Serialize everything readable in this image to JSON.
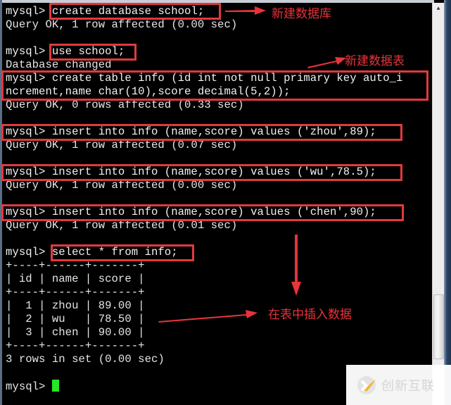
{
  "terminal": {
    "prompt": "mysql> ",
    "lines": [
      {
        "type": "cmd",
        "text": "mysql> create database school;"
      },
      {
        "type": "out",
        "text": "Query OK, 1 row affected (0.00 sec)"
      },
      {
        "type": "blank",
        "text": ""
      },
      {
        "type": "cmd",
        "text": "mysql> use school;"
      },
      {
        "type": "out",
        "text": "Database changed"
      },
      {
        "type": "cmd",
        "text": "mysql> create table info (id int not null primary key auto_i"
      },
      {
        "type": "cmd",
        "text": "ncrement,name char(10),score decimal(5,2));"
      },
      {
        "type": "out",
        "text": "Query OK, 0 rows affected (0.33 sec)"
      },
      {
        "type": "blank",
        "text": ""
      },
      {
        "type": "cmd",
        "text": "mysql> insert into info (name,score) values ('zhou',89);"
      },
      {
        "type": "out",
        "text": "Query OK, 1 row affected (0.07 sec)"
      },
      {
        "type": "blank",
        "text": ""
      },
      {
        "type": "cmd",
        "text": "mysql> insert into info (name,score) values ('wu',78.5);"
      },
      {
        "type": "out",
        "text": "Query OK, 1 row affected (0.00 sec)"
      },
      {
        "type": "blank",
        "text": ""
      },
      {
        "type": "cmd",
        "text": "mysql> insert into info (name,score) values ('chen',90);"
      },
      {
        "type": "out",
        "text": "Query OK, 1 row affected (0.01 sec)"
      },
      {
        "type": "blank",
        "text": ""
      },
      {
        "type": "cmd",
        "text": "mysql> select * from info;"
      },
      {
        "type": "out",
        "text": "+----+------+-------+"
      },
      {
        "type": "out",
        "text": "| id | name | score |"
      },
      {
        "type": "out",
        "text": "+----+------+-------+"
      },
      {
        "type": "out",
        "text": "|  1 | zhou | 89.00 |"
      },
      {
        "type": "out",
        "text": "|  2 | wu   | 78.50 |"
      },
      {
        "type": "out",
        "text": "|  3 | chen | 90.00 |"
      },
      {
        "type": "out",
        "text": "+----+------+-------+"
      },
      {
        "type": "out",
        "text": "3 rows in set (0.00 sec)"
      },
      {
        "type": "blank",
        "text": ""
      },
      {
        "type": "prompt",
        "text": "mysql> "
      }
    ],
    "result_table": {
      "columns": [
        "id",
        "name",
        "score"
      ],
      "rows": [
        [
          "1",
          "zhou",
          "89.00"
        ],
        [
          "2",
          "wu",
          "78.50"
        ],
        [
          "3",
          "chen",
          "90.00"
        ]
      ]
    },
    "cursor_color": "#27e627"
  },
  "annotations": {
    "create_db": "新建数据库",
    "create_table": "新建数据表",
    "insert_data": "在表中插入数据",
    "color": "#e8333a"
  },
  "watermark": {
    "text": "创新互联"
  }
}
